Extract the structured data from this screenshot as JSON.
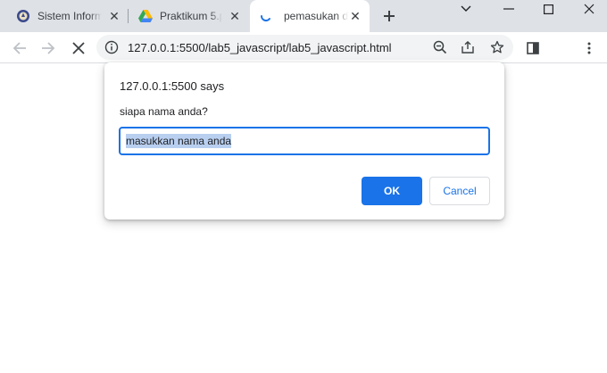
{
  "tabs": [
    {
      "title": "Sistem Inform",
      "favicon": "university-logo-icon"
    },
    {
      "title": "Praktikum 5.p",
      "favicon": "google-drive-icon"
    },
    {
      "title": "pemasukan d",
      "favicon": "loading-spinner-icon"
    }
  ],
  "address_bar": {
    "url": "127.0.0.1:5500/lab5_javascript/lab5_javascript.html"
  },
  "dialog": {
    "title": "127.0.0.1:5500 says",
    "message": "siapa nama anda?",
    "input_value": "masukkan nama anda",
    "ok_label": "OK",
    "cancel_label": "Cancel"
  },
  "colors": {
    "accent": "#1a73e8",
    "tabstrip": "#dee1e6",
    "selection": "#b8cff0"
  }
}
